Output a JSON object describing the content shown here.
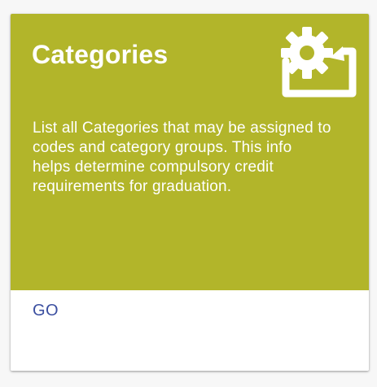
{
  "card": {
    "title": "Categories",
    "description": "List all Categories that may be assigned to codes and category groups. This info helps determine compulsory credit requirements for graduation.",
    "icon": "settings-folder-icon",
    "go_label": "GO"
  },
  "colors": {
    "card_header": "#b2b52a",
    "title_text": "#ffffff",
    "action_text": "#3b4fa0",
    "page_background": "#f7f7f7"
  }
}
